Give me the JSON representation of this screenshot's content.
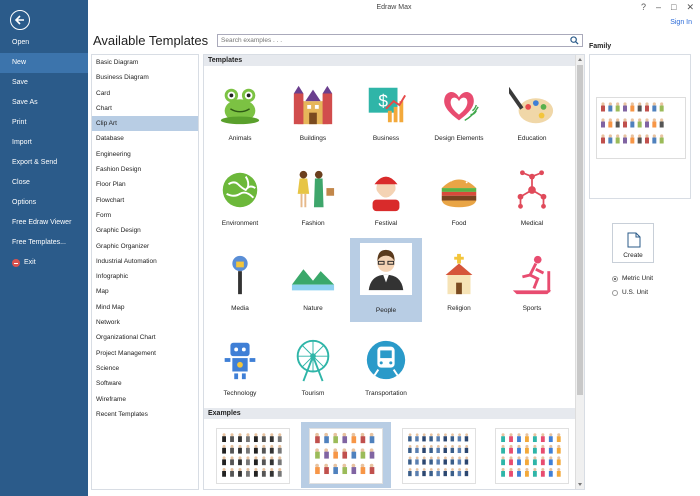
{
  "window": {
    "title": "Edraw Max",
    "sign_in": "Sign In"
  },
  "sidebar": {
    "items": [
      {
        "label": "Open"
      },
      {
        "label": "New"
      },
      {
        "label": "Save"
      },
      {
        "label": "Save As"
      },
      {
        "label": "Print"
      },
      {
        "label": "Import"
      },
      {
        "label": "Export & Send"
      },
      {
        "label": "Close"
      },
      {
        "label": "Options"
      },
      {
        "label": "Free Edraw Viewer"
      },
      {
        "label": "Free Templates..."
      },
      {
        "label": "Exit"
      }
    ],
    "active": "New"
  },
  "header": {
    "title": "Available Templates",
    "search_placeholder": "Search examples . . ."
  },
  "categories": {
    "items": [
      "Basic Diagram",
      "Business Diagram",
      "Card",
      "Chart",
      "Clip Art",
      "Database",
      "Engineering",
      "Fashion Design",
      "Floor Plan",
      "Flowchart",
      "Form",
      "Graphic Design",
      "Graphic Organizer",
      "Industrial Automation",
      "Infographic",
      "Map",
      "Mind Map",
      "Network",
      "Organizational Chart",
      "Project Management",
      "Science",
      "Software",
      "Wireframe",
      "Recent Templates"
    ],
    "selected": "Clip Art"
  },
  "templates": {
    "header": "Templates",
    "items": [
      {
        "label": "Animals",
        "icon": "frog-icon"
      },
      {
        "label": "Buildings",
        "icon": "castle-icon"
      },
      {
        "label": "Business",
        "icon": "money-chart-icon"
      },
      {
        "label": "Design Elements",
        "icon": "heart-icon"
      },
      {
        "label": "Education",
        "icon": "palette-icon"
      },
      {
        "label": "Environment",
        "icon": "globe-icon"
      },
      {
        "label": "Fashion",
        "icon": "fashion-models-icon"
      },
      {
        "label": "Festival",
        "icon": "santa-icon"
      },
      {
        "label": "Food",
        "icon": "burger-icon"
      },
      {
        "label": "Medical",
        "icon": "molecule-icon"
      },
      {
        "label": "Media",
        "icon": "microphone-icon"
      },
      {
        "label": "Nature",
        "icon": "landscape-icon"
      },
      {
        "label": "People",
        "icon": "person-icon"
      },
      {
        "label": "Religion",
        "icon": "church-icon"
      },
      {
        "label": "Sports",
        "icon": "treadmill-icon"
      },
      {
        "label": "Technology",
        "icon": "robot-icon"
      },
      {
        "label": "Tourism",
        "icon": "ferris-wheel-icon"
      },
      {
        "label": "Transportation",
        "icon": "train-icon"
      }
    ],
    "selected": "People"
  },
  "examples": {
    "header": "Examples",
    "count": 4,
    "selected_index": 1
  },
  "right_panel": {
    "preview_title": "Family",
    "create_label": "Create",
    "units": [
      {
        "label": "Metric Unit",
        "checked": true
      },
      {
        "label": "U.S. Unit",
        "checked": false
      }
    ]
  },
  "colors": {
    "sidebar": "#2b5b8a",
    "active_menu": "#3c74ac",
    "selection": "#b8cde4",
    "link": "#2a6ad8"
  }
}
